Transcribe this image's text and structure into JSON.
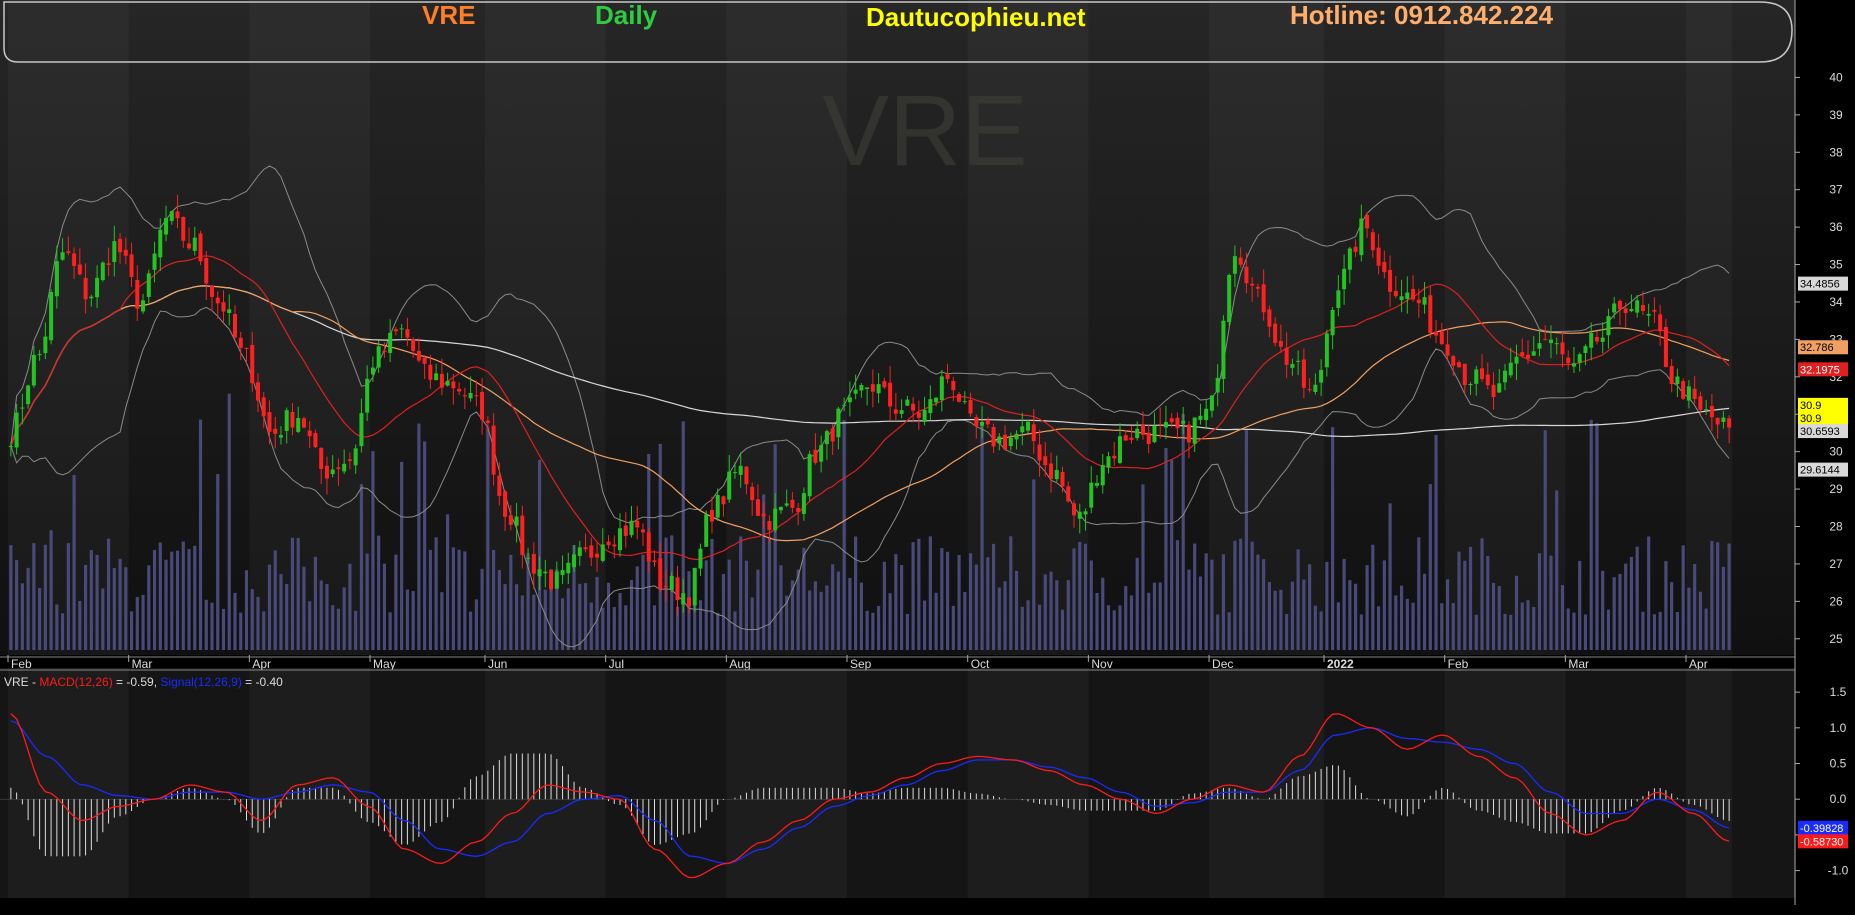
{
  "header": {
    "ticker": "VRE",
    "period": "Daily",
    "site": "Dautucophieu.net",
    "hotline": "Hotline: 0912.842.224"
  },
  "watermark": "VRE",
  "colors": {
    "ticker": "#ff7f27",
    "period": "#2ecc40",
    "site": "#ffff00",
    "hotline": "#ffae6b",
    "candle_up": "#22c322",
    "candle_down": "#ff2020",
    "ma_short": "#e02020",
    "ma_mid": "#f0a060",
    "ma_long": "#d8d8d8",
    "bollinger": "#8a8a8a",
    "volume": "#4a4a7a",
    "macd": "#ff1a1a",
    "signal": "#1a2bff",
    "histogram": "#dddddd"
  },
  "chart_data": [
    {
      "type": "candlestick",
      "ticker": "VRE",
      "x_ticks": [
        "Feb",
        "Mar",
        "Apr",
        "May",
        "Jun",
        "Jul",
        "Aug",
        "Sep",
        "Oct",
        "Nov",
        "Dec",
        "2022",
        "Feb",
        "Mar",
        "Apr"
      ],
      "y_ticks": [
        25,
        26,
        27,
        28,
        29,
        30,
        31,
        32,
        33,
        34,
        35,
        36,
        37,
        38,
        39,
        40
      ],
      "ylim": [
        24.7,
        41
      ],
      "price_anchors": [
        30.5,
        32.5,
        35.3,
        34.2,
        35.5,
        34.0,
        36.2,
        35.5,
        34.0,
        32.5,
        30.5,
        31.0,
        29.5,
        29.8,
        32.5,
        33.2,
        32.0,
        31.8,
        31.2,
        28.5,
        27.0,
        26.5,
        27.2,
        27.8,
        28.0,
        26.5,
        26.2,
        28.5,
        29.5,
        28.2,
        28.5,
        30.0,
        31.0,
        31.8,
        31.2,
        31.0,
        32.0,
        30.6,
        30.3,
        30.5,
        29.5,
        28.2,
        29.8,
        30.5,
        30.5,
        30.5,
        31.0,
        35.5,
        34.0,
        32.5,
        31.5,
        34.5,
        36.0,
        34.5,
        34.0,
        33.0,
        32.0,
        31.5,
        32.5,
        33.0,
        32.2,
        33.0,
        34.0,
        33.5,
        31.8,
        31.0,
        30.6
      ],
      "price_labels": [
        {
          "text": "34.4856",
          "value": 34.49,
          "bg": "#d8d8d8",
          "fg": "#000000"
        },
        {
          "text": "32.786",
          "value": 32.79,
          "bg": "#f0a060",
          "fg": "#000000"
        },
        {
          "text": "32.1975",
          "value": 32.2,
          "bg": "#e02020",
          "fg": "#ffffff"
        },
        {
          "text": "30.9",
          "value": 31.25,
          "bg": "#ffff00",
          "fg": "#000000"
        },
        {
          "text": "30.9",
          "value": 30.9,
          "bg": "#ffff00",
          "fg": "#000000"
        },
        {
          "text": "30.6593",
          "value": 30.55,
          "bg": "#d8d8d8",
          "fg": "#000000"
        },
        {
          "text": "29.6144",
          "value": 29.52,
          "bg": "#d8d8d8",
          "fg": "#000000"
        }
      ]
    },
    {
      "type": "line",
      "indicator": "MACD",
      "legend": {
        "ticker": "VRE - ",
        "macd_name": "MACD(12,26)",
        "macd_value": " = -0.59,",
        "signal_name": "Signal(12,26,9)",
        "signal_value": " = -0.40"
      },
      "y_ticks": [
        "1.5",
        "1.0",
        "0.5",
        "0.0",
        "-0.5",
        "-1.0"
      ],
      "ylim": [
        -1.3,
        1.6
      ],
      "macd_anchors": [
        1.2,
        0.1,
        -0.3,
        -0.1,
        0.0,
        0.2,
        0.1,
        -0.3,
        0.2,
        0.3,
        -0.1,
        -0.7,
        -0.9,
        -0.6,
        -0.2,
        0.2,
        0.1,
        0.0,
        -0.7,
        -1.1,
        -0.9,
        -0.6,
        -0.3,
        0.0,
        0.1,
        0.3,
        0.5,
        0.6,
        0.55,
        0.4,
        0.2,
        0.0,
        -0.2,
        0.0,
        0.2,
        0.1,
        0.6,
        1.2,
        1.0,
        0.7,
        0.9,
        0.6,
        0.3,
        -0.2,
        -0.5,
        -0.3,
        0.1,
        -0.2,
        -0.59
      ],
      "signal_anchors": [
        1.1,
        0.6,
        0.2,
        0.05,
        0.0,
        0.1,
        0.1,
        0.0,
        0.1,
        0.2,
        0.1,
        -0.3,
        -0.7,
        -0.8,
        -0.6,
        -0.2,
        0.0,
        0.05,
        -0.3,
        -0.8,
        -0.9,
        -0.7,
        -0.4,
        -0.1,
        0.05,
        0.2,
        0.4,
        0.55,
        0.55,
        0.45,
        0.3,
        0.1,
        -0.1,
        -0.05,
        0.1,
        0.1,
        0.4,
        0.9,
        1.0,
        0.85,
        0.8,
        0.7,
        0.5,
        0.1,
        -0.2,
        -0.2,
        0.0,
        -0.15,
        -0.4
      ],
      "value_labels": [
        {
          "text": "-0.39828",
          "value": -0.4,
          "bg": "#1a2bff",
          "fg": "#ffffff"
        },
        {
          "text": "-0.58730",
          "value": -0.59,
          "bg": "#ff1a1a",
          "fg": "#ffffff"
        }
      ]
    }
  ]
}
